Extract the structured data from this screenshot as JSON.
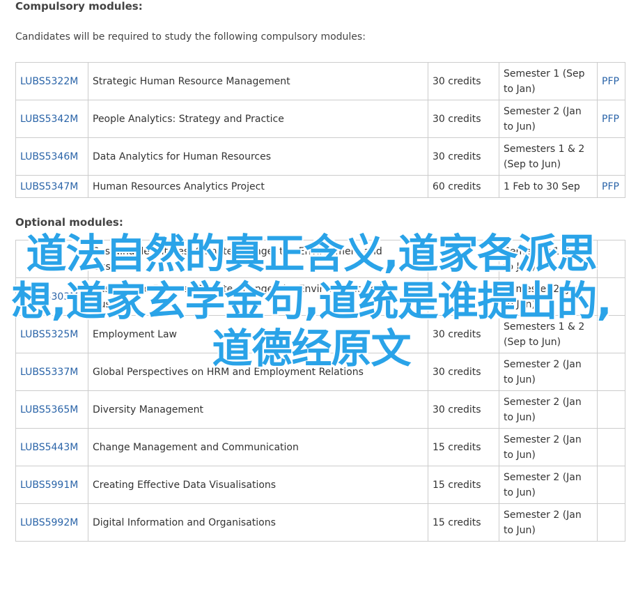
{
  "compulsory": {
    "heading": "Compulsory modules:",
    "intro": "Candidates will be required to study the following compulsory modules:",
    "rows": [
      {
        "code": "LUBS5322M",
        "title": "Strategic Human Resource Management",
        "credits": "30 credits",
        "semester": "Semester 1 (Sep to Jan)",
        "pfp": "PFP"
      },
      {
        "code": "LUBS5342M",
        "title": "People Analytics: Strategy and Practice",
        "credits": "30 credits",
        "semester": "Semester 2 (Jan to Jun)",
        "pfp": "PFP"
      },
      {
        "code": "LUBS5346M",
        "title": "Data Analytics for Human Resources",
        "credits": "30 credits",
        "semester": "Semesters 1 & 2 (Sep to Jun)",
        "pfp": ""
      },
      {
        "code": "LUBS5347M",
        "title": "Human Resources Analytics Project",
        "credits": "60 credits",
        "semester": "1 Feb to 30 Sep",
        "pfp": "PFP"
      }
    ]
  },
  "optional": {
    "heading": "Optional modules:",
    "rows": [
      {
        "code": "",
        "title": "Sustainable Futures: Climate Change, the Environment and Business",
        "credits": "",
        "semester": "Semester 1 (Jan to Jun)",
        "pfp": ""
      },
      {
        "code": "LUBS5303M",
        "title": "Sustainable Futures: Climate Change, the Environment and Business",
        "credits": "",
        "semester": "Semester 2 (Jan to Jun)",
        "pfp": ""
      },
      {
        "code": "LUBS5325M",
        "title": "Employment Law",
        "credits": "30 credits",
        "semester": "Semesters 1 & 2 (Sep to Jun)",
        "pfp": ""
      },
      {
        "code": "LUBS5337M",
        "title": "Global Perspectives on HRM and Employment Relations",
        "credits": "30 credits",
        "semester": "Semester 2 (Jan to Jun)",
        "pfp": ""
      },
      {
        "code": "LUBS5365M",
        "title": "Diversity Management",
        "credits": "30 credits",
        "semester": "Semester 2 (Jan to Jun)",
        "pfp": ""
      },
      {
        "code": "LUBS5443M",
        "title": "Change Management and Communication",
        "credits": "15 credits",
        "semester": "Semester 2 (Jan to Jun)",
        "pfp": ""
      },
      {
        "code": "LUBS5991M",
        "title": "Creating Effective Data Visualisations",
        "credits": "15 credits",
        "semester": "Semester 2 (Jan to Jun)",
        "pfp": ""
      },
      {
        "code": "LUBS5992M",
        "title": "Digital Information and Organisations",
        "credits": "15 credits",
        "semester": "Semester 2 (Jan to Jun)",
        "pfp": ""
      }
    ]
  },
  "watermark": {
    "text": "道法自然的真正含义,道家各派思想,道家玄学金句,道统是谁提出的,道德经原文",
    "color": "#2aa3e8"
  },
  "colors": {
    "link": "#2a64a8",
    "border": "#cccccc"
  }
}
